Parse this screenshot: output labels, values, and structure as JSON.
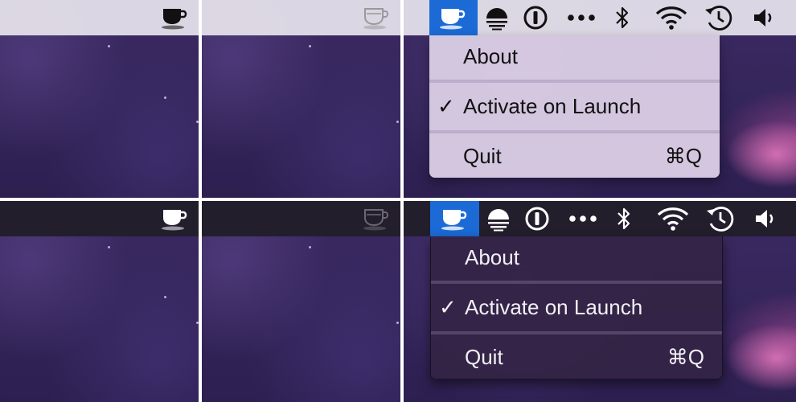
{
  "colors": {
    "menubar_light": "#e2dee8",
    "menubar_dark": "#221e2a",
    "selection_blue": "#1b6ad6",
    "wallpaper": "#34255a"
  },
  "icons": {
    "caffeine_active": "coffee-cup-icon",
    "caffeine_inactive": "coffee-cup-outline-icon",
    "sunset": "sunset-icon",
    "onepassword": "1password-keyhole-icon",
    "more": "ellipsis-icon",
    "bluetooth": "bluetooth-icon",
    "wifi": "wifi-icon",
    "time_machine": "time-machine-icon",
    "volume": "volume-icon"
  },
  "menu": {
    "about": "About",
    "activate_check": "✓",
    "activate": "Activate on Launch",
    "quit": "Quit",
    "quit_shortcut": "⌘Q"
  }
}
